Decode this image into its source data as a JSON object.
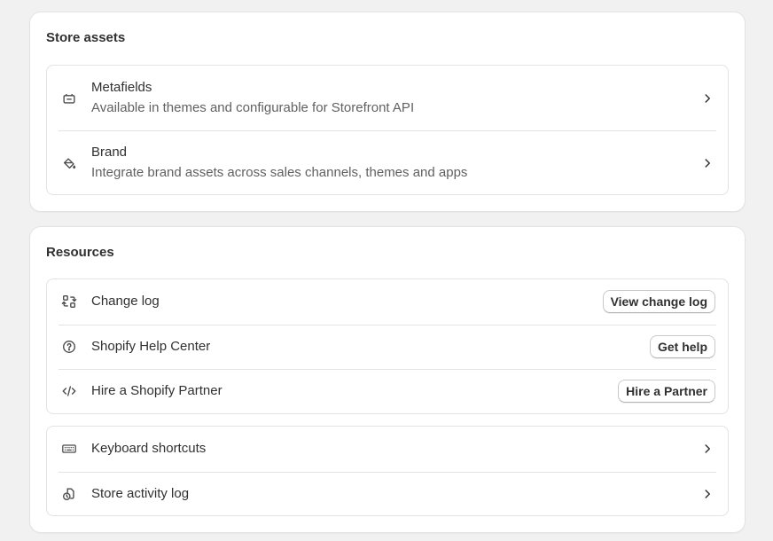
{
  "store_assets": {
    "title": "Store assets",
    "items": [
      {
        "icon": "metafields-icon",
        "label": "Metafields",
        "description": "Available in themes and configurable for Storefront API"
      },
      {
        "icon": "brand-paint-icon",
        "label": "Brand",
        "description": "Integrate brand assets across sales channels, themes and apps"
      }
    ]
  },
  "resources": {
    "title": "Resources",
    "links": [
      {
        "icon": "change-log-icon",
        "label": "Change log",
        "button": "View change log"
      },
      {
        "icon": "help-circle-icon",
        "label": "Shopify Help Center",
        "button": "Get help"
      },
      {
        "icon": "code-icon",
        "label": "Hire a Shopify Partner",
        "button": "Hire a Partner"
      }
    ],
    "nav": [
      {
        "icon": "keyboard-icon",
        "label": "Keyboard shortcuts"
      },
      {
        "icon": "store-activity-icon",
        "label": "Store activity log"
      }
    ]
  },
  "colors": {
    "background": "#f1f1f1",
    "card": "#ffffff",
    "text": "#303030",
    "subdued_text": "#616161",
    "border": "#e3e3e3"
  }
}
